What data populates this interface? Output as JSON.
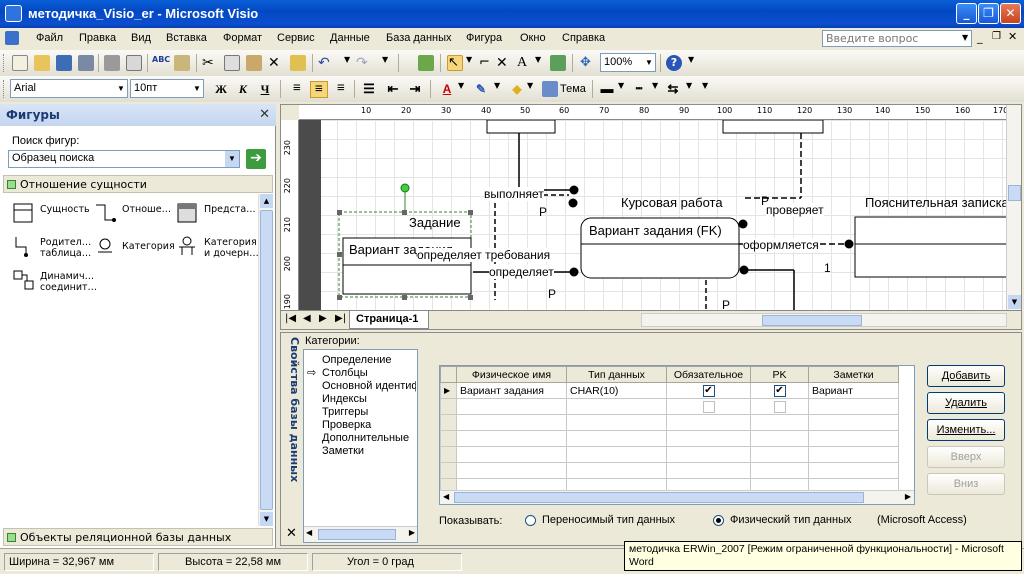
{
  "window": {
    "title": "методичка_Visio_er - Microsoft Visio"
  },
  "menu": {
    "items": [
      "Файл",
      "Правка",
      "Вид",
      "Вставка",
      "Формат",
      "Сервис",
      "Данные",
      "База данных",
      "Фигура",
      "Окно",
      "Справка"
    ],
    "ask_placeholder": "Введите вопрос"
  },
  "toolbar": {
    "zoom": "100%",
    "font": "Arial",
    "font_size": "10пт",
    "bold": "Ж",
    "italic": "К",
    "underline": "Ч",
    "theme": "Тема"
  },
  "shapes_panel": {
    "title": "Фигуры",
    "search_label": "Поиск фигур:",
    "search_value": "Образец поиска",
    "stencil": "Отношение сущности",
    "shapes": [
      {
        "label": "Сущность",
        "icon": "entity-icon"
      },
      {
        "label": "Отноше…",
        "icon": "relationship-icon"
      },
      {
        "label": "Предста…",
        "icon": "view-icon"
      },
      {
        "label": "Родител… таблица…",
        "icon": "parent-table-icon"
      },
      {
        "label": "Категория",
        "icon": "category-icon"
      },
      {
        "label": "Категория и дочерн…",
        "icon": "category-child-icon"
      },
      {
        "label": "Динамич… соединит…",
        "icon": "dynamic-connector-icon"
      }
    ],
    "bottom_stencil": "Объекты реляционной базы данных"
  },
  "ruler": {
    "h": [
      "10",
      "20",
      "30",
      "40",
      "50",
      "60",
      "70",
      "80",
      "90",
      "100",
      "110",
      "120",
      "130",
      "140",
      "150",
      "160",
      "170"
    ],
    "v": [
      "230",
      "220",
      "210",
      "200",
      "190"
    ]
  },
  "diagram": {
    "labels": {
      "zadanie": "Задание",
      "variant1": "Вариант задания",
      "vypolnyaet": "выполняет",
      "p1": "P",
      "opredelyaet_treb": "определяет требования",
      "opredelyaet": "определяет",
      "p2": "P",
      "kursovaya": "Курсовая работа",
      "variant_fk": "Вариант задания (FK)",
      "p3": "P",
      "proveryaet": "проверяет",
      "oformlyaetsya": "оформляется",
      "one": "1",
      "poyasnit": "Пояснительная записка",
      "p4": "P"
    }
  },
  "page_tab": "Страница-1",
  "db_panel": {
    "title": "Свойства базы данных",
    "categories_label": "Категории:",
    "categories": [
      "Определение",
      "Столбцы",
      "Основной идентификатор",
      "Индексы",
      "Триггеры",
      "Проверка",
      "Дополнительные",
      "Заметки"
    ],
    "selected_category": "Столбцы",
    "columns": [
      "Физическое имя",
      "Тип данных",
      "Обязательное",
      "PK",
      "Заметки"
    ],
    "rows": [
      {
        "name": "Вариант задания",
        "type": "CHAR(10)",
        "required": true,
        "pk": true,
        "notes": "Вариант"
      }
    ],
    "buttons": {
      "add": "Добавить",
      "delete": "Удалить",
      "edit": "Изменить...",
      "up": "Вверх",
      "down": "Вниз"
    },
    "show_label": "Показывать:",
    "radio_portable": "Переносимый тип данных",
    "radio_physical": "Физический тип данных",
    "driver": "(Microsoft Access)"
  },
  "status": {
    "width": "Ширина = 32,967 мм",
    "height": "Высота = 22,58 мм",
    "angle": "Угол = 0 град"
  },
  "tooltip": "методичка ERWin_2007 [Режим ограниченной функциональности] - Microsoft Word"
}
